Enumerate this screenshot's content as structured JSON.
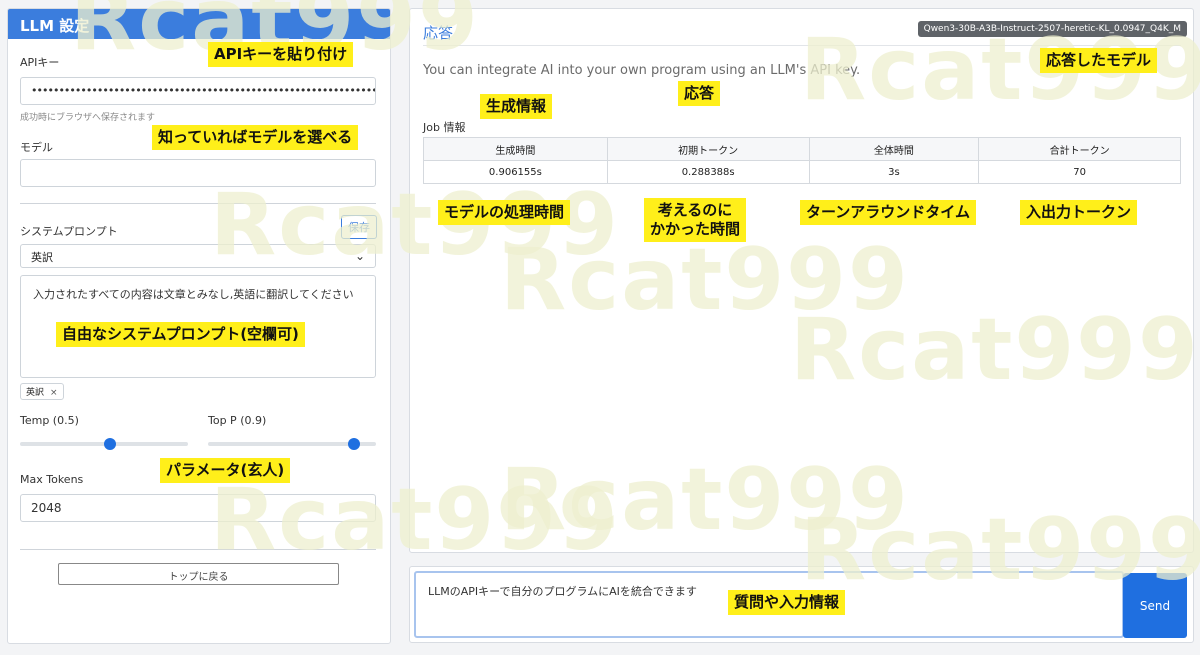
{
  "left_panel": {
    "title": "LLM 設定",
    "api_key_label": "APIキー",
    "api_key_value": "••••••••••••••••••••••••••••••••••••••••••••••••••••••••••••••••••••",
    "api_key_hint": "成功時にブラウザへ保存されます",
    "model_label": "モデル",
    "model_value": "",
    "system_prompt_label": "システムプロンプト",
    "save_label": "保存",
    "preset_selected": "英訳",
    "system_prompt_text": "入力されたすべての内容は文章とみなし,英語に翻訳してください",
    "chip_label": "英訳",
    "chip_close": "×",
    "temp_label": "Temp (0.5)",
    "temp_value": 0.5,
    "top_p_label": "Top P (0.9)",
    "top_p_value": 0.9,
    "max_tokens_label": "Max Tokens",
    "max_tokens_value": "2048",
    "back_to_top": "トップに戻る"
  },
  "right_panel": {
    "title": "応答",
    "model_badge": "Qwen3-30B-A3B-Instruct-2507-heretic-KL_0.0947_Q4K_M",
    "response_text": "You can integrate AI into your own program using an LLM's API key.",
    "job_label": "Job 情報",
    "job_table": {
      "headers": [
        "生成時間",
        "初期トークン",
        "全体時間",
        "合計トークン"
      ],
      "values": [
        "0.906155s",
        "0.288388s",
        "3s",
        "70"
      ]
    }
  },
  "question": {
    "text": "LLMのAPIキーで自分のプログラムにAIを統合できます",
    "send_label": "Send"
  },
  "annotations": {
    "paste_api": "APIキーを貼り付け",
    "choose_model": "知っていればモデルを選べる",
    "free_prompt": "自由なシステムプロンプト(空欄可)",
    "params": "パラメータ(玄人)",
    "gen_info": "生成情報",
    "response": "応答",
    "responded_model": "応答したモデル",
    "model_proc_time": "モデルの処理時間",
    "think_time": "考えるのに\nかかった時間",
    "turnaround": "ターンアラウンドタイム",
    "io_tokens": "入出力トークン",
    "question_input": "質問や入力情報"
  },
  "watermark": "Rcat999"
}
